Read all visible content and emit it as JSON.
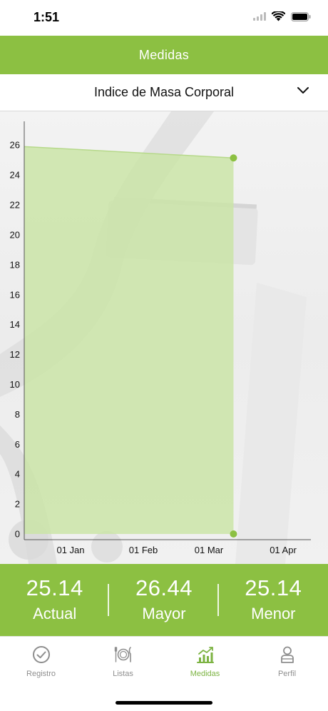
{
  "status_bar": {
    "time": "1:51",
    "icons": [
      "signal-icon",
      "wifi-icon",
      "battery-icon"
    ]
  },
  "nav": {
    "title": "Medidas"
  },
  "selector": {
    "label": "Indice de Masa Corporal",
    "chevron_icon": "chevron-down-icon"
  },
  "colors": {
    "accent": "#8cc042",
    "area_fill": "#c9e4a5",
    "active_tab": "#7cb342",
    "inactive_tab": "#8e8e8e"
  },
  "chart_data": {
    "type": "area",
    "title": "",
    "xlabel": "",
    "ylabel": "",
    "y_ticks": [
      0,
      2,
      4,
      6,
      8,
      10,
      12,
      14,
      16,
      18,
      20,
      22,
      24,
      26
    ],
    "x_ticks": [
      "01 Jan",
      "01 Feb",
      "01 Mar",
      "01 Apr"
    ],
    "ylim": [
      0,
      27.3
    ],
    "xlim": [
      "2021-12-10",
      "2021-04-10"
    ],
    "series": [
      {
        "x": [
          "2021-12-10",
          "2022-03-11"
        ],
        "values": [
          25.9,
          25.14
        ]
      }
    ],
    "markers": [
      {
        "x": "2022-03-11",
        "y": 25.14
      },
      {
        "x": "2022-03-11",
        "y": 0
      }
    ],
    "grid": false
  },
  "stats": [
    {
      "value": "25.14",
      "label": "Actual"
    },
    {
      "value": "26.44",
      "label": "Mayor"
    },
    {
      "value": "25.14",
      "label": "Menor"
    }
  ],
  "tabs": [
    {
      "label": "Registro",
      "icon": "check-circle-icon",
      "active": false
    },
    {
      "label": "Listas",
      "icon": "plate-cutlery-icon",
      "active": false
    },
    {
      "label": "Medidas",
      "icon": "chart-trend-icon",
      "active": true
    },
    {
      "label": "Perfil",
      "icon": "user-icon",
      "active": false
    }
  ]
}
